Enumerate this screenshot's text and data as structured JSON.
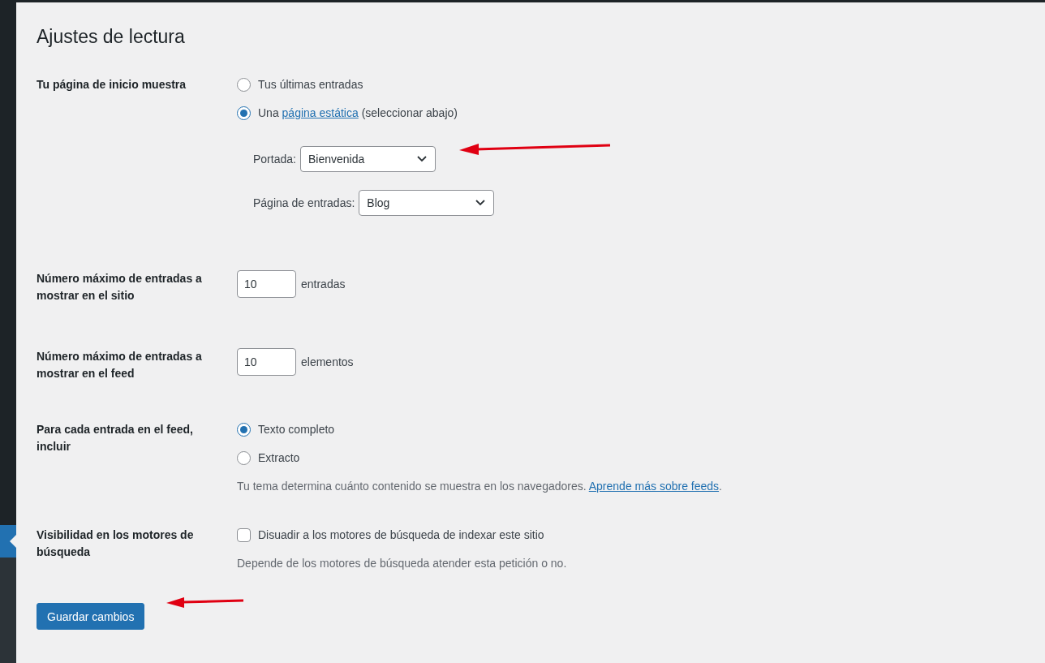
{
  "title": "Ajustes de lectura",
  "rows": [
    {
      "kind": "radio",
      "label": "Tu página de inicio muestra",
      "options": [
        {
          "text": "Tus últimas entradas",
          "selected": false
        },
        {
          "text": "Una",
          "link": "página estática",
          "after": "(seleccionar abajo)",
          "selected": true
        }
      ],
      "selects": [
        {
          "label": "Portada:",
          "value": "Bienvenida"
        },
        {
          "label": "Página de entradas:",
          "value": "Blog"
        }
      ]
    },
    {
      "kind": "number",
      "label": "Número máximo de entradas a mostrar en el sitio",
      "value": "10",
      "unit": "entradas"
    },
    {
      "kind": "number",
      "label": "Número máximo de entradas a mostrar en el feed",
      "value": "10",
      "unit": "elementos"
    },
    {
      "kind": "radio",
      "label": "Para cada entrada en el feed, incluir",
      "options": [
        {
          "text": "Texto completo",
          "selected": true
        },
        {
          "text": "Extracto",
          "selected": false
        }
      ],
      "description": {
        "text": "Tu tema determina cuánto contenido se muestra en los navegadores.",
        "link": "Aprende más sobre feeds",
        "after": "."
      }
    },
    {
      "kind": "checkbox",
      "label": "Visibilidad en los motores de búsqueda",
      "text": "Disuadir a los motores de búsqueda de indexar este sitio",
      "checked": false,
      "description": {
        "text": "Depende de los motores de búsqueda atender esta petición o no."
      }
    }
  ],
  "save_button": "Guardar cambios"
}
